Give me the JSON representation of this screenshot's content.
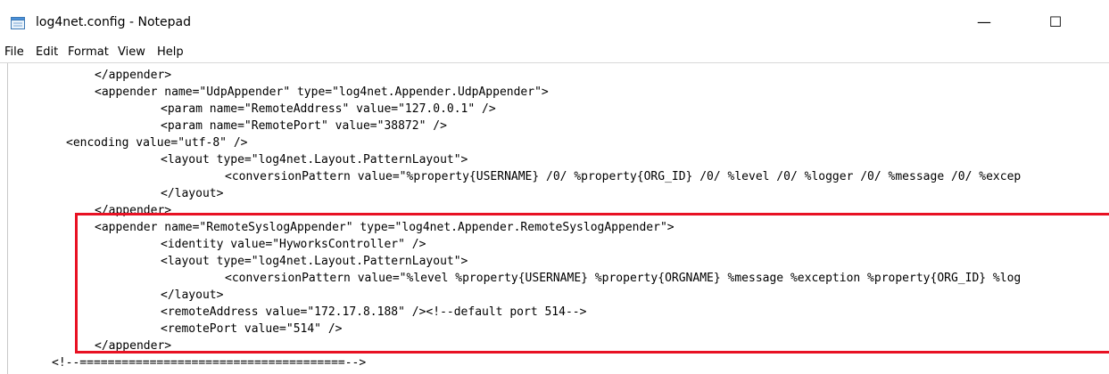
{
  "window": {
    "title": "log4net.config - Notepad",
    "minimize_glyph": "—",
    "maximize_glyph": "☐",
    "close_glyph": "✕"
  },
  "menu": {
    "items": [
      "File",
      "Edit",
      "Format",
      "View",
      "Help"
    ]
  },
  "editor": {
    "lines": [
      "</appender>",
      "<appender name=\"UdpAppender\" type=\"log4net.Appender.UdpAppender\">",
      "<param name=\"RemoteAddress\" value=\"127.0.0.1\" />",
      "<param name=\"RemotePort\" value=\"38872\" />",
      "<encoding value=\"utf-8\" />",
      "<layout type=\"log4net.Layout.PatternLayout\">",
      "<conversionPattern value=\"%property{USERNAME} /0/ %property{ORG_ID} /0/ %level /0/ %logger /0/ %message /0/ %excep",
      "</layout>",
      "</appender>",
      "<appender name=\"RemoteSyslogAppender\" type=\"log4net.Appender.RemoteSyslogAppender\">",
      "<identity value=\"HyworksController\" />",
      "<layout type=\"log4net.Layout.PatternLayout\">",
      "<conversionPattern value=\"%level %property{USERNAME} %property{ORGNAME} %message %exception %property{ORG_ID} %log",
      "</layout>",
      "<remoteAddress value=\"172.17.8.188\" /><!--default port 514-->",
      "<remotePort value=\"514\" />",
      "</appender>",
      "<!--======================================-->"
    ]
  },
  "colors": {
    "highlight": "#e81123",
    "icon_blue": "#4a90d9"
  },
  "icons": {
    "app": "notepad-icon"
  }
}
